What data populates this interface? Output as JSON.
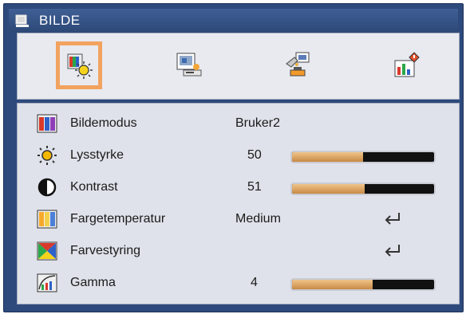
{
  "window": {
    "title": "BILDE"
  },
  "tabs": [
    {
      "icon": "picture-settings-icon",
      "active": true
    },
    {
      "icon": "display-settings-icon",
      "active": false
    },
    {
      "icon": "setup-icon",
      "active": false
    },
    {
      "icon": "options-icon",
      "active": false
    }
  ],
  "rows": {
    "bildemodus": {
      "label": "Bildemodus",
      "value": "Bruker2",
      "icon": "color-mode-icon"
    },
    "lysstyrke": {
      "label": "Lysstyrke",
      "value": "50",
      "icon": "brightness-icon",
      "level": 0.5
    },
    "kontrast": {
      "label": "Kontrast",
      "value": "51",
      "icon": "contrast-icon",
      "level": 0.51
    },
    "fargetemperatur": {
      "label": "Fargetemperatur",
      "value": "Medium",
      "icon": "color-temperature-icon"
    },
    "farvestyring": {
      "label": "Farvestyring",
      "icon": "color-settings-icon"
    },
    "gamma": {
      "label": "Gamma",
      "value": "4",
      "icon": "gamma-icon",
      "level": 0.57
    }
  },
  "colors": {
    "frame": "#2e4a7d",
    "panel": "#dfe2ea",
    "active_tab": "#f2a35f",
    "slider_fill": "#d9a060"
  }
}
